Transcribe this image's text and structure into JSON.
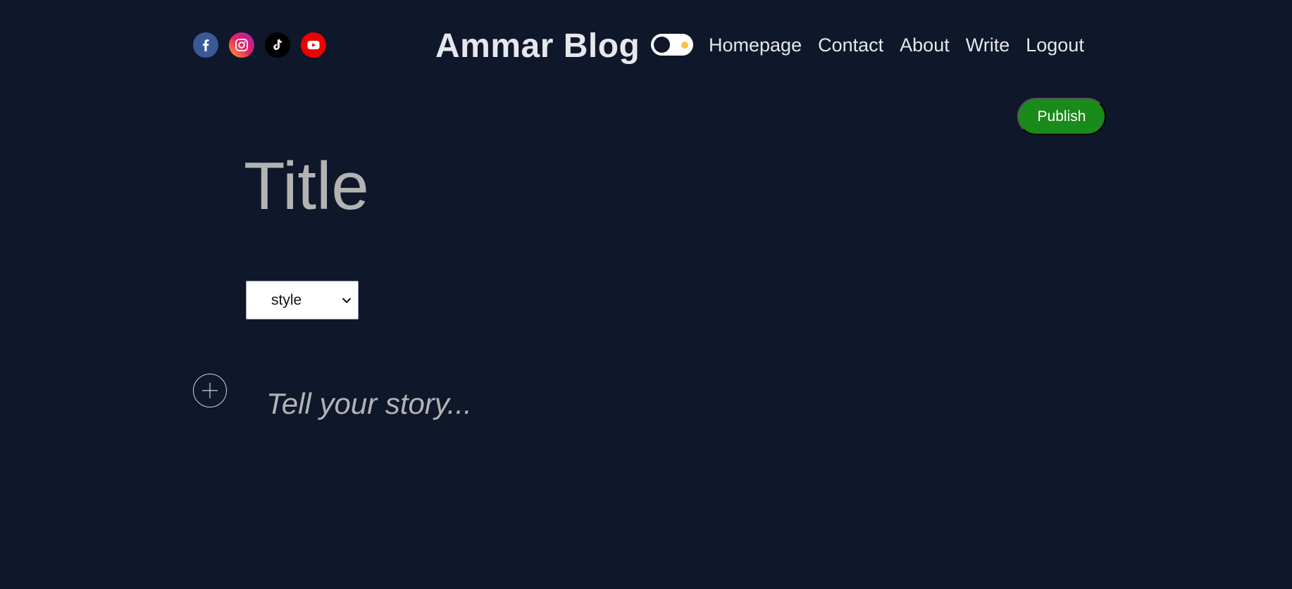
{
  "header": {
    "social": [
      {
        "icon": "facebook-icon",
        "color": "#3b5998"
      },
      {
        "icon": "instagram-icon",
        "color": "#e91e63"
      },
      {
        "icon": "tiktok-icon",
        "color": "#000000"
      },
      {
        "icon": "youtube-icon",
        "color": "#ef0000"
      }
    ],
    "logo": "Ammar Blog",
    "theme_toggle": {
      "state": "dark",
      "icon": "sun-icon"
    },
    "nav": {
      "homepage": "Homepage",
      "contact": "Contact",
      "about": "About",
      "write": "Write",
      "logout": "Logout"
    }
  },
  "editor": {
    "publish_label": "Publish",
    "title_placeholder": "Title",
    "style_select": {
      "selected": "style",
      "icon": "chevron-down-icon"
    },
    "add_icon": "plus-icon",
    "story_placeholder": "Tell your story..."
  },
  "colors": {
    "background": "#0f172a",
    "text": "#e5e7eb",
    "publish": "#1a8a1a",
    "placeholder": "#b3b3b3",
    "toggle_sun": "#f5c542"
  }
}
